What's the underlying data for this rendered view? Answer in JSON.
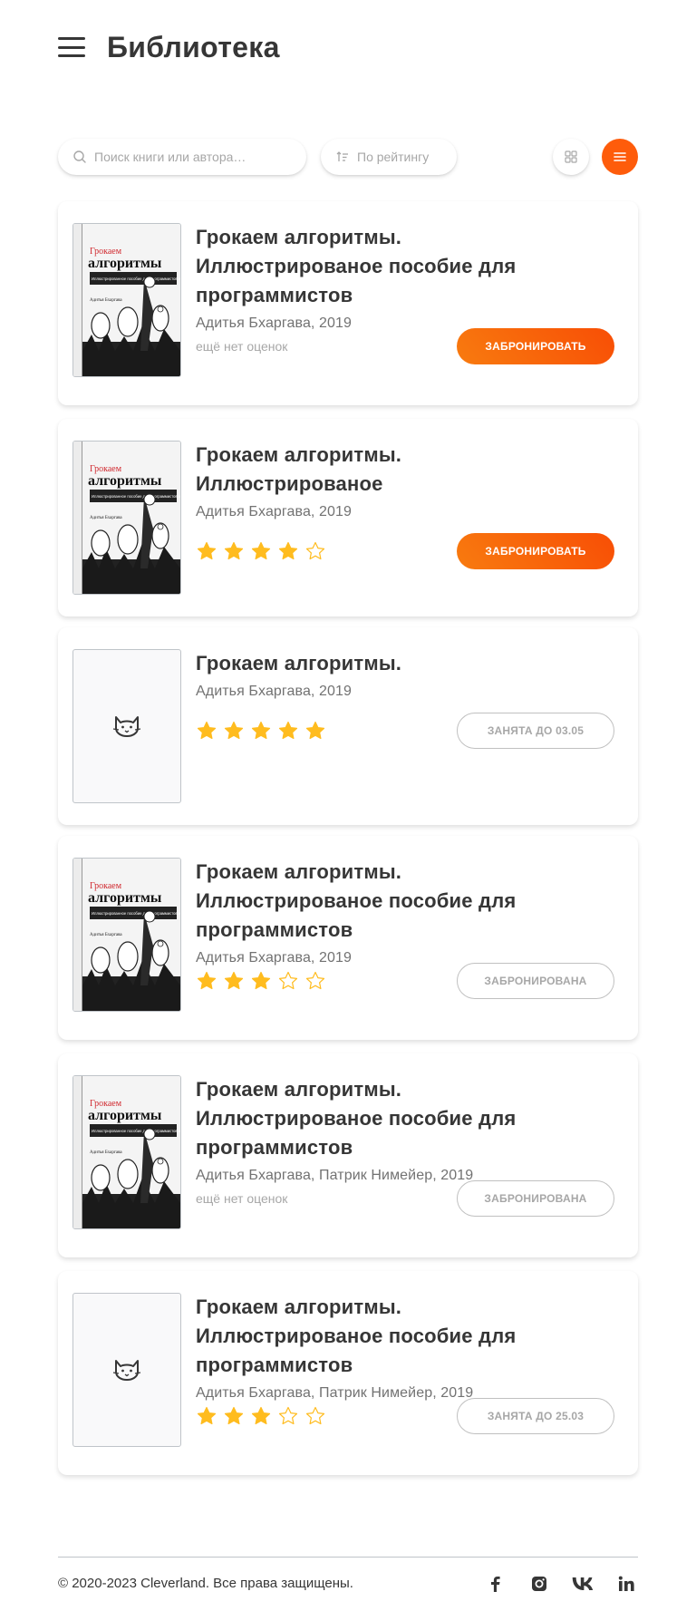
{
  "header": {
    "menu_icon": "burger-menu-icon",
    "title": "Библиотека"
  },
  "toolbar": {
    "search": {
      "placeholder": "Поиск книги или автора…",
      "value": "",
      "icon": "search-icon"
    },
    "sort": {
      "label": "По рейтингу",
      "icon": "sort-descending-icon"
    },
    "view_tile_icon": "grid-icon",
    "view_list_icon": "list-icon",
    "active_view": "list"
  },
  "colors": {
    "accent": "#fd5f0a",
    "star": "#ffbc1f",
    "text": "#363636",
    "muted": "#727272"
  },
  "books": [
    {
      "title": "Грокаем алгоритмы. Иллюстрированое пособие для программистов",
      "author": "Адитья Бхаргава, 2019",
      "cover": "image",
      "rating": null,
      "no_rating_text": "ещё нет оценок",
      "button": {
        "label": "ЗАБРОНИРОВАТЬ",
        "style": "primary"
      }
    },
    {
      "title": "Грокаем алгоритмы. Иллюстрированое",
      "author": "Адитья Бхаргава, 2019",
      "cover": "image",
      "rating": 4,
      "button": {
        "label": "ЗАБРОНИРОВАТЬ",
        "style": "primary"
      }
    },
    {
      "title": "Грокаем алгоритмы.",
      "author": "Адитья Бхаргава, 2019",
      "cover": "placeholder",
      "rating": 5,
      "button": {
        "label": "ЗАНЯТА ДО 03.05",
        "style": "outline"
      }
    },
    {
      "title": "Грокаем алгоритмы. Иллюстрированое пособие для программистов",
      "author": "Адитья Бхаргава, 2019",
      "cover": "image",
      "rating": 3,
      "button": {
        "label": "ЗАБРОНИРОВАНА",
        "style": "outline"
      }
    },
    {
      "title": "Грокаем алгоритмы. Иллюстрированое пособие для программистов",
      "author": "Адитья Бхаргава, Патрик Нимейер, 2019",
      "cover": "image",
      "rating": null,
      "no_rating_text": "ещё нет оценок",
      "button": {
        "label": "ЗАБРОНИРОВАНА",
        "style": "outline"
      }
    },
    {
      "title": "Грокаем алгоритмы. Иллюстрированое пособие для программистов",
      "author": "Адитья Бхаргава, Патрик Нимейер, 2019",
      "cover": "placeholder",
      "rating": 3,
      "button": {
        "label": "ЗАНЯТА ДО 25.03",
        "style": "outline"
      }
    }
  ],
  "cover_art": {
    "red_word": "Грокаем",
    "black_word": "алгоритмы",
    "subtitle": "Иллюстрированное пособие для программистов и любопытных",
    "author": "Адитья Бхаргава"
  },
  "footer": {
    "copyright": "© 2020-2023 Cleverland. Все права защищены.",
    "socials": [
      "facebook-icon",
      "instagram-icon",
      "vk-icon",
      "linkedin-icon"
    ]
  }
}
